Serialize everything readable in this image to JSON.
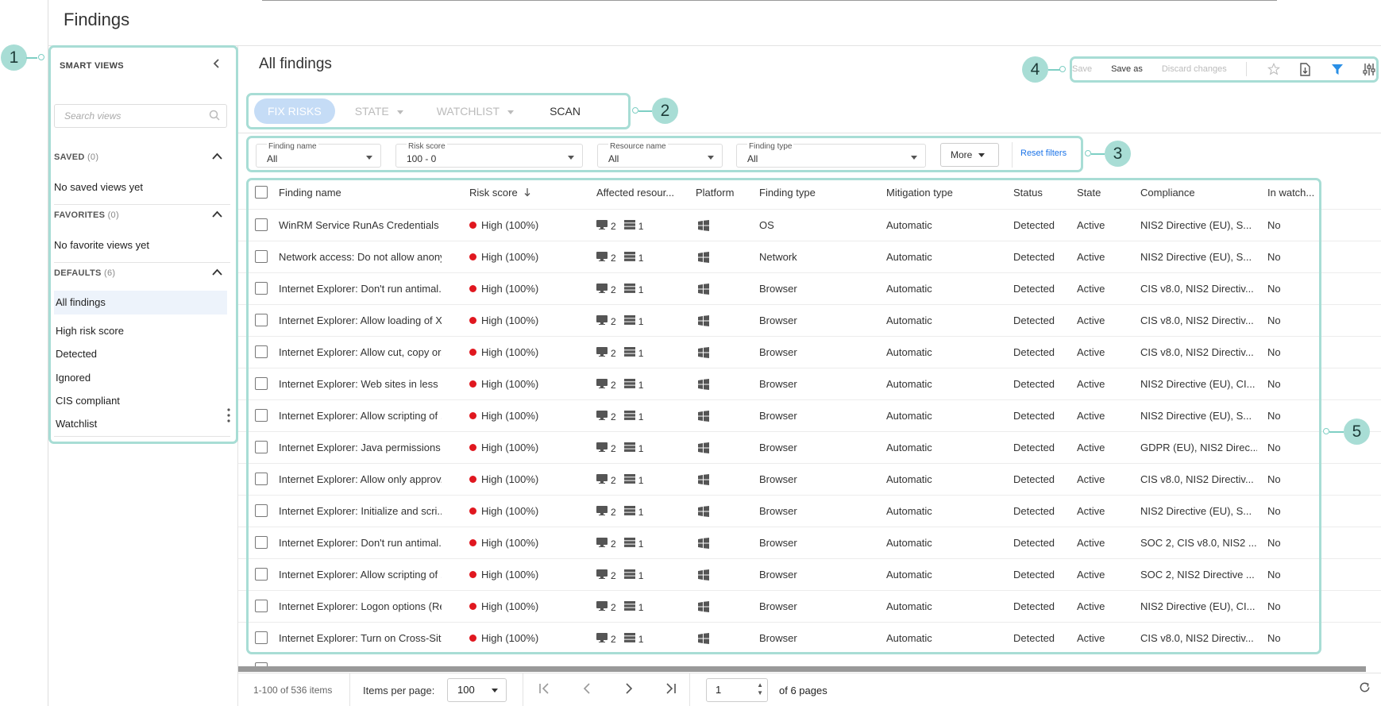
{
  "page": {
    "title": "Findings"
  },
  "sidebar": {
    "title": "SMART VIEWS",
    "search_placeholder": "Search views",
    "saved": {
      "label": "SAVED",
      "count": "(0)",
      "empty": "No saved views yet"
    },
    "favorites": {
      "label": "FAVORITES",
      "count": "(0)",
      "empty": "No favorite views yet"
    },
    "defaults": {
      "label": "DEFAULTS",
      "count": "(6)",
      "items": [
        "All findings",
        "High risk score",
        "Detected",
        "Ignored",
        "CIS compliant",
        "Watchlist"
      ]
    }
  },
  "main": {
    "title": "All findings",
    "toolbar": {
      "save": "Save",
      "save_as": "Save as",
      "discard": "Discard changes"
    },
    "tabs": {
      "fix_risks": "FIX RISKS",
      "state": "STATE",
      "watchlist": "WATCHLIST",
      "scan": "SCAN"
    },
    "filters": {
      "finding_name": {
        "label": "Finding name",
        "value": "All"
      },
      "risk_score": {
        "label": "Risk score",
        "value": "100 - 0"
      },
      "resource_name": {
        "label": "Resource name",
        "value": "All"
      },
      "finding_type": {
        "label": "Finding type",
        "value": "All"
      },
      "more": "More",
      "reset": "Reset filters"
    }
  },
  "table": {
    "columns": {
      "finding_name": "Finding name",
      "risk_score": "Risk score",
      "affected": "Affected resour...",
      "platform": "Platform",
      "finding_type": "Finding type",
      "mitigation": "Mitigation type",
      "status": "Status",
      "state": "State",
      "compliance": "Compliance",
      "watchlist": "In watch..."
    },
    "rows": [
      {
        "name": "WinRM Service RunAs Credentials",
        "risk": "High (100%)",
        "endpoints": "2",
        "servers": "1",
        "platform_icon": "windows-icon",
        "type": "OS",
        "mitigation": "Automatic",
        "status": "Detected",
        "state": "Active",
        "compliance": "NIS2 Directive (EU), S...",
        "watch": "No"
      },
      {
        "name": "Network access: Do not allow anony...",
        "risk": "High (100%)",
        "endpoints": "2",
        "servers": "1",
        "platform_icon": "windows-icon",
        "type": "Network",
        "mitigation": "Automatic",
        "status": "Detected",
        "state": "Active",
        "compliance": "NIS2 Directive (EU), S...",
        "watch": "No"
      },
      {
        "name": "Internet Explorer: Don't run antimal...",
        "risk": "High (100%)",
        "endpoints": "2",
        "servers": "1",
        "platform_icon": "windows-icon",
        "type": "Browser",
        "mitigation": "Automatic",
        "status": "Detected",
        "state": "Active",
        "compliance": "CIS v8.0, NIS2 Directiv...",
        "watch": "No"
      },
      {
        "name": "Internet Explorer: Allow loading of X...",
        "risk": "High (100%)",
        "endpoints": "2",
        "servers": "1",
        "platform_icon": "windows-icon",
        "type": "Browser",
        "mitigation": "Automatic",
        "status": "Detected",
        "state": "Active",
        "compliance": "CIS v8.0, NIS2 Directiv...",
        "watch": "No"
      },
      {
        "name": "Internet Explorer: Allow cut, copy or...",
        "risk": "High (100%)",
        "endpoints": "2",
        "servers": "1",
        "platform_icon": "windows-icon",
        "type": "Browser",
        "mitigation": "Automatic",
        "status": "Detected",
        "state": "Active",
        "compliance": "CIS v8.0, NIS2 Directiv...",
        "watch": "No"
      },
      {
        "name": "Internet Explorer: Web sites in less ...",
        "risk": "High (100%)",
        "endpoints": "2",
        "servers": "1",
        "platform_icon": "windows-icon",
        "type": "Browser",
        "mitigation": "Automatic",
        "status": "Detected",
        "state": "Active",
        "compliance": "NIS2 Directive (EU), CI...",
        "watch": "No"
      },
      {
        "name": "Internet Explorer: Allow scripting of ...",
        "risk": "High (100%)",
        "endpoints": "2",
        "servers": "1",
        "platform_icon": "windows-icon",
        "type": "Browser",
        "mitigation": "Automatic",
        "status": "Detected",
        "state": "Active",
        "compliance": "NIS2 Directive (EU), S...",
        "watch": "No"
      },
      {
        "name": "Internet Explorer: Java permissions ...",
        "risk": "High (100%)",
        "endpoints": "2",
        "servers": "1",
        "platform_icon": "windows-icon",
        "type": "Browser",
        "mitigation": "Automatic",
        "status": "Detected",
        "state": "Active",
        "compliance": "GDPR (EU), NIS2 Direc...",
        "watch": "No"
      },
      {
        "name": "Internet Explorer: Allow only approv...",
        "risk": "High (100%)",
        "endpoints": "2",
        "servers": "1",
        "platform_icon": "windows-icon",
        "type": "Browser",
        "mitigation": "Automatic",
        "status": "Detected",
        "state": "Active",
        "compliance": "CIS v8.0, NIS2 Directiv...",
        "watch": "No"
      },
      {
        "name": "Internet Explorer: Initialize and scri...",
        "risk": "High (100%)",
        "endpoints": "2",
        "servers": "1",
        "platform_icon": "windows-icon",
        "type": "Browser",
        "mitigation": "Automatic",
        "status": "Detected",
        "state": "Active",
        "compliance": "NIS2 Directive (EU), S...",
        "watch": "No"
      },
      {
        "name": "Internet Explorer: Don't run antimal...",
        "risk": "High (100%)",
        "endpoints": "2",
        "servers": "1",
        "platform_icon": "windows-icon",
        "type": "Browser",
        "mitigation": "Automatic",
        "status": "Detected",
        "state": "Active",
        "compliance": "SOC 2, CIS v8.0, NIS2 ...",
        "watch": "No"
      },
      {
        "name": "Internet Explorer: Allow scripting of ...",
        "risk": "High (100%)",
        "endpoints": "2",
        "servers": "1",
        "platform_icon": "windows-icon",
        "type": "Browser",
        "mitigation": "Automatic",
        "status": "Detected",
        "state": "Active",
        "compliance": "SOC 2, NIS2 Directive ...",
        "watch": "No"
      },
      {
        "name": "Internet Explorer: Logon options (Re...",
        "risk": "High (100%)",
        "endpoints": "2",
        "servers": "1",
        "platform_icon": "windows-icon",
        "type": "Browser",
        "mitigation": "Automatic",
        "status": "Detected",
        "state": "Active",
        "compliance": "NIS2 Directive (EU), CI...",
        "watch": "No"
      },
      {
        "name": "Internet Explorer: Turn on Cross-Sit...",
        "risk": "High (100%)",
        "endpoints": "2",
        "servers": "1",
        "platform_icon": "windows-icon",
        "type": "Browser",
        "mitigation": "Automatic",
        "status": "Detected",
        "state": "Active",
        "compliance": "CIS v8.0, NIS2 Directiv...",
        "watch": "No"
      }
    ]
  },
  "pager": {
    "range": "1-100 of 536 items",
    "items_per_page_label": "Items per page:",
    "items_per_page": "100",
    "page": "1",
    "of_pages": "of 6 pages"
  },
  "callouts": [
    "1",
    "2",
    "3",
    "4",
    "5"
  ],
  "colors": {
    "accent": "#a8ddd5",
    "risk_high": "#e0171f",
    "link": "#1a73e8",
    "tab_active": "#c5dcf6"
  }
}
